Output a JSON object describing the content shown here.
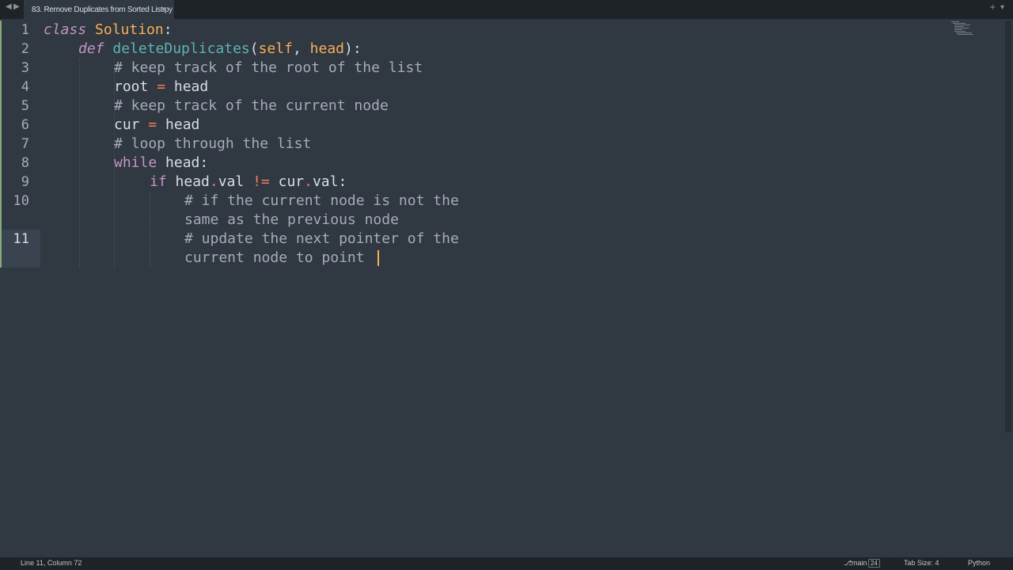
{
  "tabs": {
    "active_title": "83. Remove Duplicates from Sorted List.py",
    "nav_back": "◀",
    "nav_forward": "▶",
    "new_tab": "+",
    "tab_menu": "▾"
  },
  "editor": {
    "line_numbers": [
      "1",
      "2",
      "3",
      "4",
      "5",
      "6",
      "7",
      "8",
      "9",
      "10",
      "11"
    ],
    "code": {
      "l1_kw": "class",
      "l1_name": "Solution",
      "l1_colon": ":",
      "l2_kw": "def",
      "l2_fn": "deleteDuplicates",
      "l2_open": "(",
      "l2_self": "self",
      "l2_comma": ", ",
      "l2_head": "head",
      "l2_close": "):",
      "l3": "# keep track of the root of the list",
      "l4_var": "root ",
      "l4_op": "=",
      "l4_val": " head",
      "l5": "# keep track of the current node",
      "l6_var": "cur ",
      "l6_op": "=",
      "l6_val": " head",
      "l7": "# loop through the list",
      "l8_kw": "while",
      "l8_rest": " head:",
      "l9_kw": "if",
      "l9_a": " head",
      "l9_dot1": ".",
      "l9_b": "val ",
      "l9_op": "!=",
      "l9_c": " cur",
      "l9_dot2": ".",
      "l9_d": "val:",
      "l10a": "# if the current node is not the",
      "l10b": "same as the previous node",
      "l11a": "# update the next pointer of the",
      "l11b": "current node to point "
    }
  },
  "status": {
    "position": "Line 11, Column 72",
    "branch_icon": "branch-icon",
    "branch": "main",
    "branch_count": "24",
    "tab_size": "Tab Size: 4",
    "syntax": "Python"
  },
  "colors": {
    "background": "#303841",
    "keyword": "#c594c5",
    "class_name": "#f9ae58",
    "function": "#5fb4b4",
    "comment": "#a6acb9",
    "operator": "#f97b58"
  }
}
